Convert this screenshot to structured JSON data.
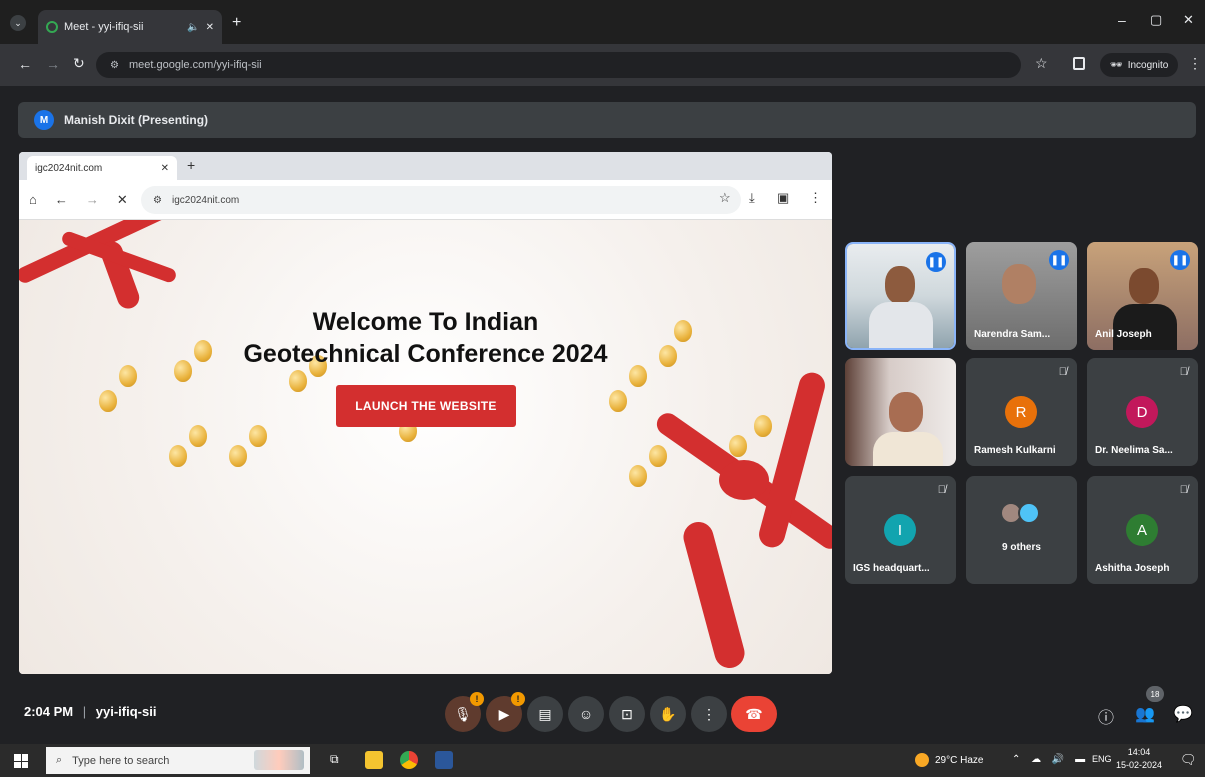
{
  "browser": {
    "tab_title": "Meet - yyi-ifiq-sii",
    "tab_close": "✕",
    "new_tab": "+",
    "url": "meet.google.com/yyi-ifiq-sii",
    "incognito_label": "Incognito",
    "window_controls": [
      "–",
      "▢",
      "✕"
    ]
  },
  "presenter": {
    "initial": "M",
    "label": "Manish Dixit (Presenting)"
  },
  "shared_screen": {
    "tab_title": "igc2024nit.com",
    "url": "igc2024nit.com",
    "welcome_line1": "Welcome To Indian",
    "welcome_line2": "Geotechnical Conference 2024",
    "launch_button": "LAUNCH THE WEBSITE"
  },
  "participants": [
    {
      "name": "",
      "type": "video",
      "speaking": true
    },
    {
      "name": "Narendra Sam...",
      "type": "video",
      "speaking": true
    },
    {
      "name": "Anil Joseph",
      "type": "video",
      "speaking": true
    },
    {
      "name": "",
      "type": "video",
      "muted": false
    },
    {
      "name": "Ramesh Kulkarni",
      "initial": "R",
      "color": "#e8710a",
      "muted": true
    },
    {
      "name": "Dr. Neelima Sa...",
      "initial": "D",
      "color": "#c2185b",
      "muted": true
    },
    {
      "name": "IGS headquart...",
      "initial": "I",
      "color": "#12a4af",
      "muted": true
    },
    {
      "name": "9 others",
      "type": "others"
    },
    {
      "name": "Ashitha Joseph",
      "initial": "A",
      "color": "#2e7d32",
      "muted": true
    }
  ],
  "bottom_bar": {
    "time": "2:04 PM",
    "separator": "|",
    "meeting_code": "yyi-ifiq-sii",
    "people_count": "18"
  },
  "taskbar": {
    "search_placeholder": "Type here to search",
    "weather": "29°C Haze",
    "language": "ENG",
    "time": "14:04",
    "date": "15-02-2024"
  },
  "colors": {
    "meet_bg": "#202124",
    "end_call": "#ea4335",
    "launch_button": "#d32f2f",
    "accent": "#1a73e8"
  }
}
